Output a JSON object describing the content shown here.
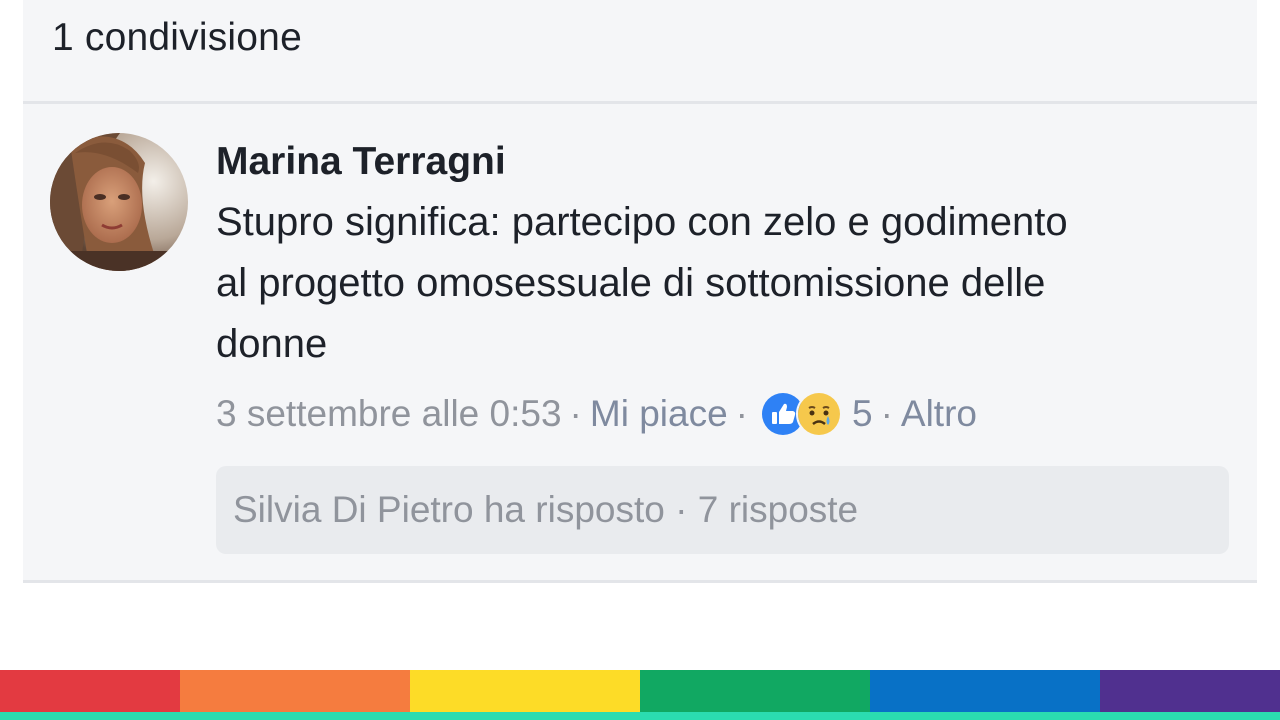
{
  "post": {
    "shares_text": "1 condivisione"
  },
  "comment": {
    "author": "Marina Terragni",
    "text": "Stupro significa: partecipo con zelo e godimento al progetto omosessuale di sottomissione delle donne",
    "timestamp": "3 settembre alle 0:53",
    "separator": "·",
    "like_label": "Mi piace",
    "reactions": {
      "icons": [
        "like-icon",
        "sad-icon"
      ],
      "count": "5"
    },
    "more_label": "Altro",
    "replies_text": "Silvia Di Pietro ha risposto · 7 risposte"
  },
  "colors": {
    "text_primary": "#1d2129",
    "text_secondary": "#90949c",
    "link_gray": "#7f8a9f",
    "like_blue": "#2e81f5",
    "sad_yellow": "#f6c84c",
    "card_background": "#f5f6f8",
    "replies_background": "#e9ebee",
    "rainbow": [
      "#e33a41",
      "#f57c3f",
      "#fddc27",
      "#11a862",
      "#0871c6",
      "#50308f"
    ],
    "underline": "#2bdcb0"
  }
}
